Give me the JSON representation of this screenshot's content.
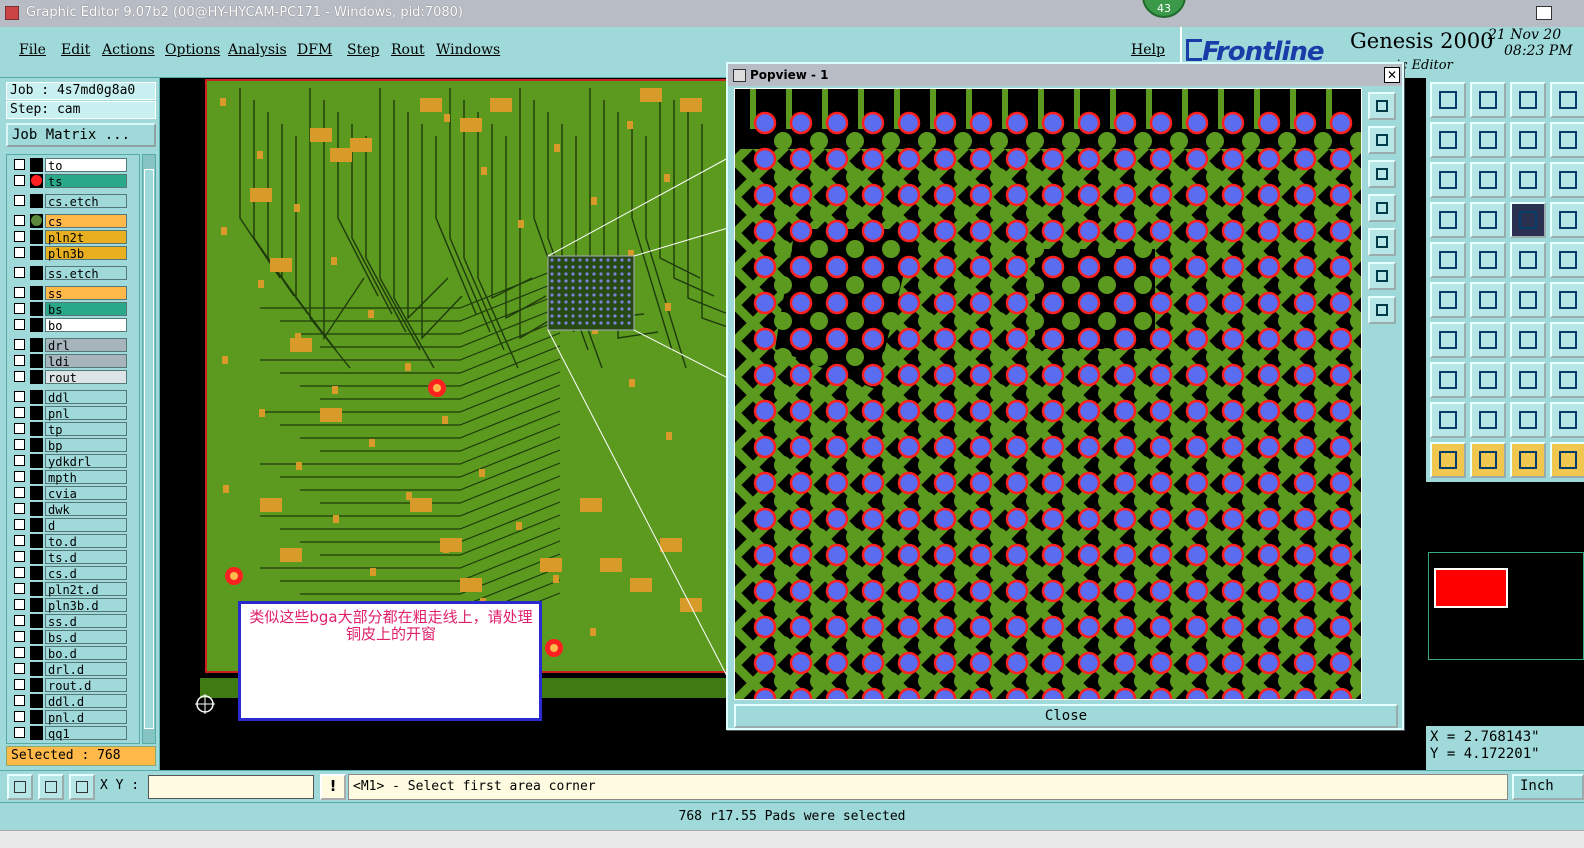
{
  "titlebar": {
    "text": "Graphic Editor 9.07b2 (00@HY-HYCAM-PC171 - Windows, pid:7080)",
    "badge": "43"
  },
  "menu": {
    "items": [
      "File",
      "Edit",
      "Actions",
      "Options",
      "Analysis",
      "DFM",
      "Step",
      "Rout",
      "Windows"
    ],
    "help": "Help"
  },
  "brand": {
    "logo": "Frontline",
    "product": "Genesis 2000",
    "subtitle": "ic Editor",
    "date": "21 Nov 20",
    "time": "08:23 PM"
  },
  "job": {
    "job_label": "Job : 4s7md0g8a0",
    "step_label": "Step: cam",
    "matrix_button": "Job Matrix ..."
  },
  "layers": [
    {
      "name": "to",
      "color": "#ffffff",
      "mark": "#000000"
    },
    {
      "name": "ts",
      "color": "#2aa88a",
      "mark": "#ff2020"
    },
    {
      "name": "cs.etch",
      "color": "#9fd9d9",
      "mark": "#000000"
    },
    {
      "name": "cs",
      "color": "#ffb84a",
      "mark": "#5a8a3a"
    },
    {
      "name": "pln2t",
      "color": "#e8b020",
      "mark": "#000000"
    },
    {
      "name": "pln3b",
      "color": "#e8b020",
      "mark": "#000000"
    },
    {
      "name": "ss.etch",
      "color": "#9fd9d9",
      "mark": "#000000"
    },
    {
      "name": "ss",
      "color": "#ffb84a",
      "mark": "#000000"
    },
    {
      "name": "bs",
      "color": "#2aa88a",
      "mark": "#000000"
    },
    {
      "name": "bo",
      "color": "#ffffff",
      "mark": "#000000"
    },
    {
      "name": "drl",
      "color": "#a8b4bc",
      "mark": "#000000"
    },
    {
      "name": "ldi",
      "color": "#a8b4bc",
      "mark": "#000000"
    },
    {
      "name": "rout",
      "color": "#dde4e6",
      "mark": "#000000"
    },
    {
      "name": "ddl",
      "color": "#9fd9d9",
      "mark": "#000000"
    },
    {
      "name": "pnl",
      "color": "#9fd9d9",
      "mark": "#000000"
    },
    {
      "name": "tp",
      "color": "#9fd9d9",
      "mark": "#000000"
    },
    {
      "name": "bp",
      "color": "#9fd9d9",
      "mark": "#000000"
    },
    {
      "name": "ydkdrl",
      "color": "#9fd9d9",
      "mark": "#000000"
    },
    {
      "name": "mpth",
      "color": "#9fd9d9",
      "mark": "#000000"
    },
    {
      "name": "cvia",
      "color": "#9fd9d9",
      "mark": "#000000"
    },
    {
      "name": "dwk",
      "color": "#9fd9d9",
      "mark": "#000000"
    },
    {
      "name": "d",
      "color": "#9fd9d9",
      "mark": "#000000"
    },
    {
      "name": "to.d",
      "color": "#9fd9d9",
      "mark": "#000000"
    },
    {
      "name": "ts.d",
      "color": "#9fd9d9",
      "mark": "#000000"
    },
    {
      "name": "cs.d",
      "color": "#9fd9d9",
      "mark": "#000000"
    },
    {
      "name": "pln2t.d",
      "color": "#9fd9d9",
      "mark": "#000000"
    },
    {
      "name": "pln3b.d",
      "color": "#9fd9d9",
      "mark": "#000000"
    },
    {
      "name": "ss.d",
      "color": "#9fd9d9",
      "mark": "#000000"
    },
    {
      "name": "bs.d",
      "color": "#9fd9d9",
      "mark": "#000000"
    },
    {
      "name": "bo.d",
      "color": "#9fd9d9",
      "mark": "#000000"
    },
    {
      "name": "drl.d",
      "color": "#9fd9d9",
      "mark": "#000000"
    },
    {
      "name": "rout.d",
      "color": "#9fd9d9",
      "mark": "#000000"
    },
    {
      "name": "ddl.d",
      "color": "#9fd9d9",
      "mark": "#000000"
    },
    {
      "name": "pnl.d",
      "color": "#9fd9d9",
      "mark": "#000000"
    },
    {
      "name": "qq1",
      "color": "#9fd9d9",
      "mark": "#000000"
    }
  ],
  "selected_label": "Selected : 768",
  "popview": {
    "title": "Popview - 1",
    "close_x": "✕",
    "close_button": "Close"
  },
  "note": {
    "text": "类似这些bga大部分都在粗走线上，请处理铜皮上的开窗"
  },
  "coords": {
    "x": "X = 2.768143\"",
    "y": "Y = 4.172201\""
  },
  "command": {
    "xy_label": "X Y :",
    "xy_value": "",
    "prompt_button": "!",
    "prompt": "<M1> - Select first area corner",
    "unit": "Inch"
  },
  "status": {
    "text": "768 r17.55 Pads were selected"
  },
  "colors": {
    "board": "#5b9a1e",
    "pad": "#5a6df0",
    "ring": "#ff2020",
    "copper": "#d89a28",
    "panel": "#9fd9d9"
  }
}
